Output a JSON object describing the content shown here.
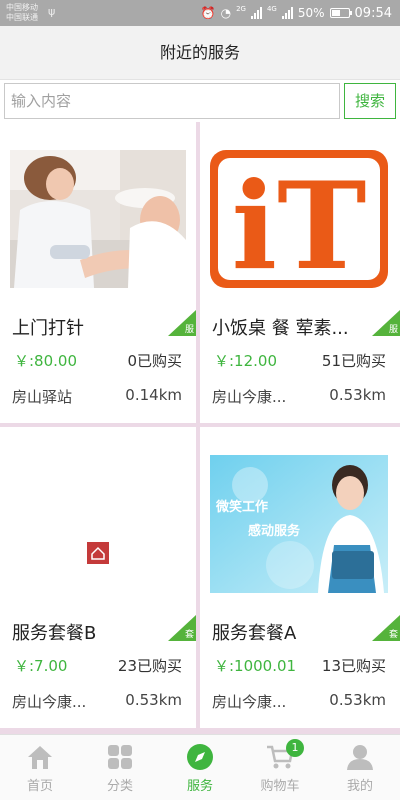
{
  "status_bar": {
    "carrier_1": "中国移动",
    "carrier_2": "中国联通",
    "network_1": "2G",
    "network_2": "4G",
    "battery": "50%",
    "time": "09:54"
  },
  "header": {
    "title": "附近的服务"
  },
  "search": {
    "placeholder": "输入内容",
    "value": "",
    "button_label": "搜索"
  },
  "services": [
    {
      "name": "上门打针",
      "tag": "服",
      "price": "￥:80.00",
      "sold": "0已购买",
      "location": "房山驿站",
      "distance": "0.14km"
    },
    {
      "name": "小饭桌 餐 荤素...",
      "tag": "服",
      "price": "￥:12.00",
      "sold": "51已购买",
      "location": "房山今康...",
      "distance": "0.53km",
      "logo_text": "iT"
    },
    {
      "name": "服务套餐B",
      "tag": "套",
      "price": "￥:7.00",
      "sold": "23已购买",
      "location": "房山今康...",
      "distance": "0.53km"
    },
    {
      "name": "服务套餐A",
      "tag": "套",
      "price": "￥:1000.01",
      "sold": "13已购买",
      "location": "房山今康...",
      "distance": "0.53km",
      "banner_line_1": "微笑工作",
      "banner_line_2": "感动服务"
    }
  ],
  "tabs": [
    {
      "label": "首页",
      "icon": "home-icon"
    },
    {
      "label": "分类",
      "icon": "grid-icon"
    },
    {
      "label": "服务",
      "icon": "compass-icon",
      "active": true
    },
    {
      "label": "购物车",
      "icon": "cart-icon",
      "badge": "1"
    },
    {
      "label": "我的",
      "icon": "user-icon"
    }
  ],
  "colors": {
    "accent": "#3fb53f",
    "tag_green": "#55b33b",
    "logo_orange": "#ea5a17",
    "divider_pink": "#ecd9e6"
  }
}
